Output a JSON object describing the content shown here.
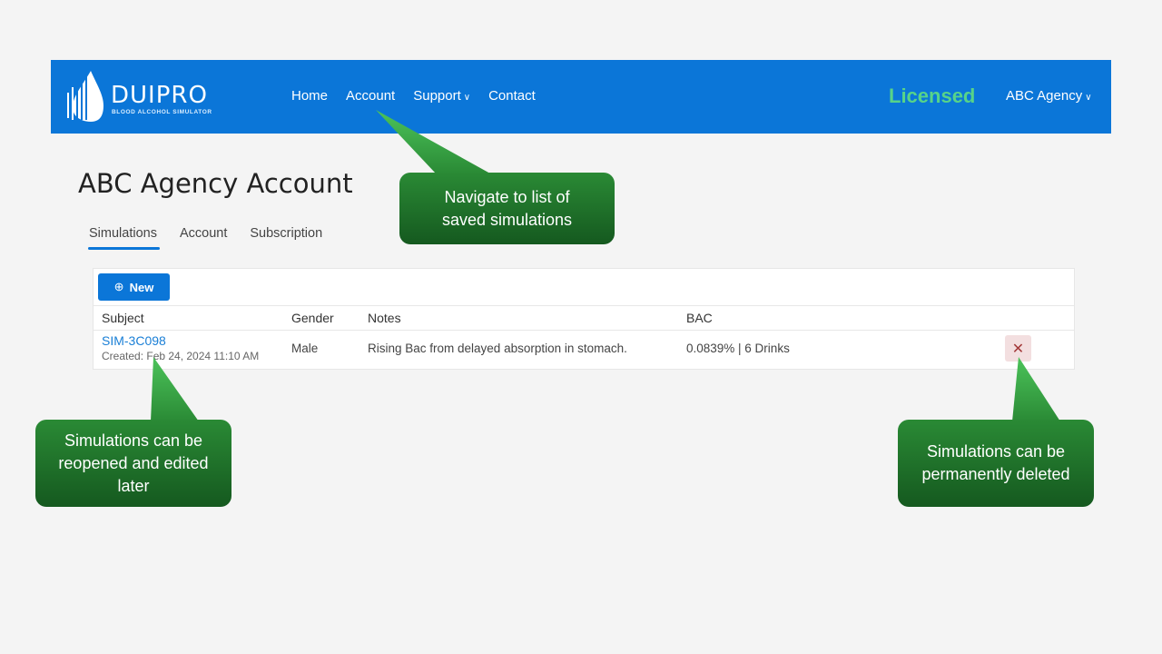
{
  "brand": {
    "name": "DUIPRO",
    "tagline": "BLOOD ALCOHOL SIMULATOR",
    "primary_color": "#0b76d8",
    "licensed_color": "#57d389"
  },
  "nav": {
    "links": [
      {
        "label": "Home"
      },
      {
        "label": "Account"
      },
      {
        "label": "Support",
        "dropdown": true
      },
      {
        "label": "Contact"
      }
    ],
    "chevron": "⌄",
    "license_status": "Licensed",
    "user_menu": "ABC Agency"
  },
  "page": {
    "title": "ABC Agency Account",
    "tabs": [
      {
        "label": "Simulations",
        "active": true
      },
      {
        "label": "Account",
        "active": false
      },
      {
        "label": "Subscription",
        "active": false
      }
    ]
  },
  "simulations": {
    "new_button": {
      "icon": "⊕",
      "label": "New"
    },
    "columns": [
      "Subject",
      "Gender",
      "Notes",
      "BAC"
    ],
    "rows": [
      {
        "subject": "SIM-3C098",
        "created": "Created: Feb 24, 2024 11:10 AM",
        "gender": "Male",
        "notes": "Rising Bac from delayed absorption in stomach.",
        "bac": "0.0839% | 6 Drinks",
        "delete_icon": "✕"
      }
    ]
  },
  "callouts": {
    "nav": "Navigate to list of saved simulations",
    "reopen": "Simulations can be reopened and edited later",
    "delete": "Simulations can be permanently deleted"
  }
}
